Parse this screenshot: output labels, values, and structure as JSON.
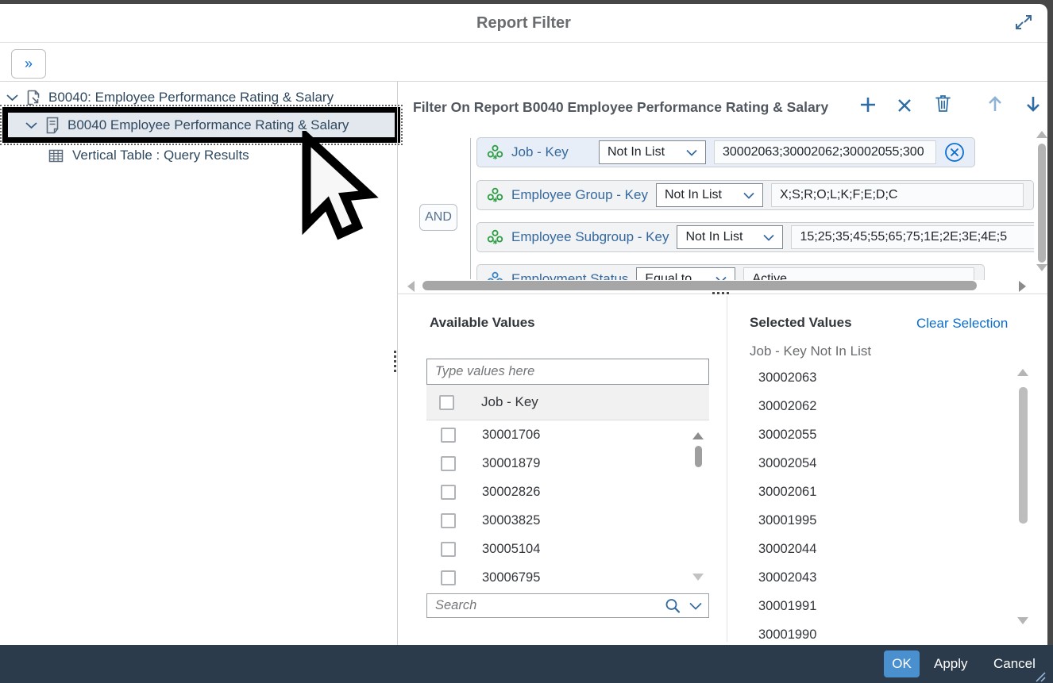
{
  "dialog": {
    "title": "Report Filter"
  },
  "toolbar": {
    "collapse_label": "»"
  },
  "tree": {
    "root_label": "B0040: Employee Performance Rating & Salary",
    "report_label": "B0040 Employee Performance Rating & Salary",
    "table_label": "Vertical Table : Query Results"
  },
  "filter": {
    "title": "Filter On Report B0040 Employee Performance Rating & Salary",
    "operator": "AND",
    "rows": [
      {
        "name": "Job - Key",
        "op": "Not In List",
        "value": "30002063;30002062;30002055;300"
      },
      {
        "name": "Employee Group - Key",
        "op": "Not In List",
        "value": "X;S;R;O;L;K;F;E;D;C"
      },
      {
        "name": "Employee Subgroup - Key",
        "op": "Not In List",
        "value": "15;25;35;45;55;65;75;1E;2E;3E;4E;5"
      },
      {
        "name": "Employment Status",
        "op": "Equal to",
        "value": "Active"
      }
    ]
  },
  "available": {
    "title": "Available Values",
    "input_placeholder": "Type values here",
    "group_label": "Job - Key",
    "values": [
      "30001706",
      "30001879",
      "30002826",
      "30003825",
      "30005104",
      "30006795"
    ],
    "search_placeholder": "Search"
  },
  "selected": {
    "title": "Selected Values",
    "clear_label": "Clear Selection",
    "condition_label": "Job - Key Not In List",
    "values": [
      "30002063",
      "30002062",
      "30002055",
      "30002054",
      "30002061",
      "30001995",
      "30002044",
      "30002043",
      "30001991",
      "30001990"
    ]
  },
  "footer": {
    "ok": "OK",
    "apply": "Apply",
    "cancel": "Cancel"
  },
  "colors": {
    "link_blue": "#0a6ed1",
    "label_blue": "#35699e",
    "icon_blue": "#2e6da4",
    "dimension_green": "#2f9e44",
    "dimension_blue": "#3a87c8",
    "footer_bg": "#2b3b4b",
    "ok_button_bg": "#4a90cf",
    "highlight_row_bg": "#e2e8ee",
    "selected_filter_row_bg": "#e7eef7"
  }
}
